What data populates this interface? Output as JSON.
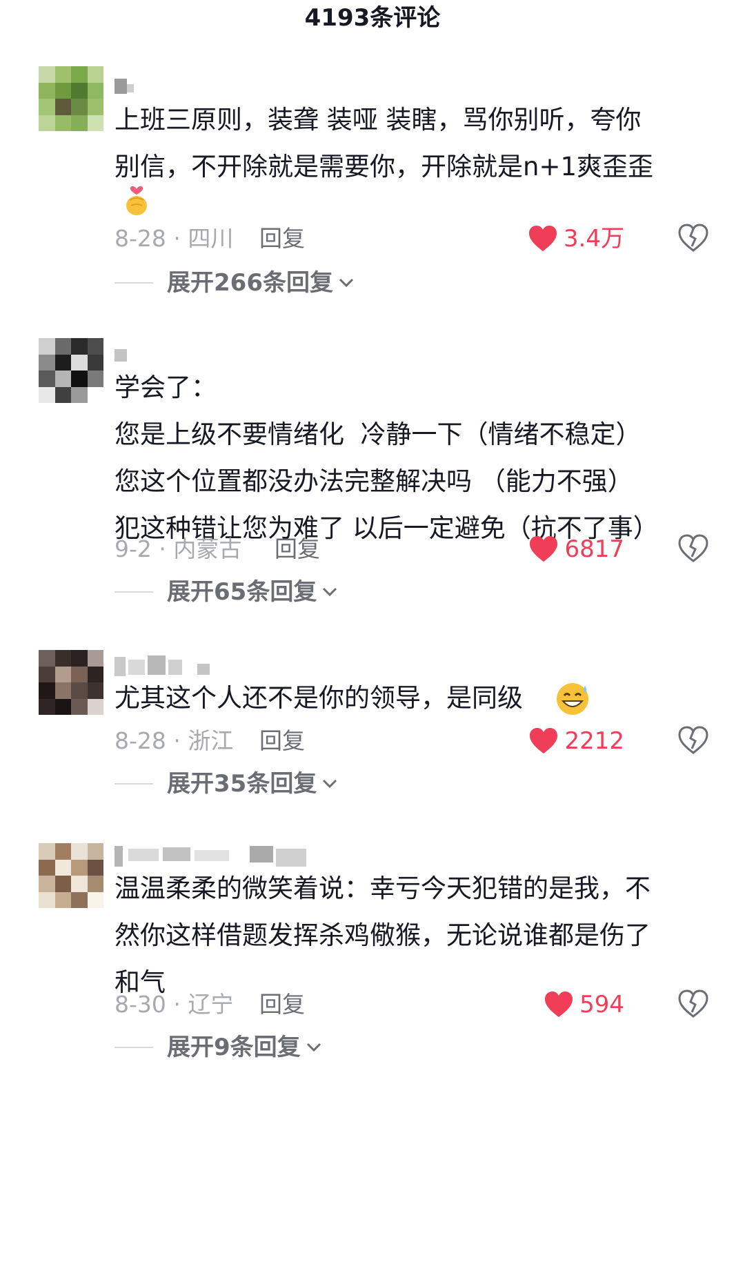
{
  "header": {
    "title": "4193条评论"
  },
  "comments": [
    {
      "text": "上班三原则，装聋 装哑 装瞎，骂你别听，夸你\n别信，不开除就是需要你，开除就是n+1爽歪歪",
      "emoji": "finger-heart-emoji",
      "date_location": "8-28 · 四川",
      "reply_label": "回复",
      "likes": "3.4万",
      "expand_label": "展开266条回复"
    },
    {
      "text": "学会了：\n您是上级不要情绪化  冷静一下（情绪不稳定）\n您这个位置都没办法完整解决吗 （能力不强）\n犯这种错让您为难了 以后一定避免（抗不了事）",
      "date_location": "9-2 · 内蒙古",
      "reply_label": "回复",
      "likes": "6817",
      "expand_label": "展开65条回复"
    },
    {
      "text": "尤其这个人还不是你的领导，是同级",
      "emoji": "grin-sweat-emoji",
      "date_location": "8-28 · 浙江",
      "reply_label": "回复",
      "likes": "2212",
      "expand_label": "展开35条回复"
    },
    {
      "text": "温温柔柔的微笑着说：幸亏今天犯错的是我，不\n然你这样借题发挥杀鸡儆猴，无论说谁都是伤了\n和气",
      "date_location": "8-30 · 辽宁",
      "reply_label": "回复",
      "likes": "594",
      "expand_label": "展开9条回复"
    }
  ],
  "colors": {
    "like_red": "#f03d58",
    "meta_gray": "#a7a9ae",
    "reply_gray": "#6b6d74"
  },
  "icons": {
    "like": "heart-icon",
    "dislike": "broken-heart-icon",
    "expand": "chevron-down-icon"
  }
}
